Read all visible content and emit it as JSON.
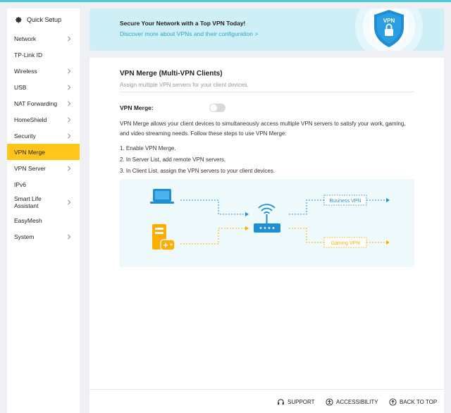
{
  "sidebar": {
    "quick_setup": "Quick Setup",
    "items": [
      {
        "label": "Network",
        "arrow": true
      },
      {
        "label": "TP-Link ID",
        "arrow": false
      },
      {
        "label": "Wireless",
        "arrow": true
      },
      {
        "label": "USB",
        "arrow": true
      },
      {
        "label": "NAT Forwarding",
        "arrow": true
      },
      {
        "label": "HomeShield",
        "arrow": true
      },
      {
        "label": "Security",
        "arrow": true
      },
      {
        "label": "VPN Merge",
        "arrow": false,
        "active": true
      },
      {
        "label": "VPN Server",
        "arrow": true
      },
      {
        "label": "IPv6",
        "arrow": false
      },
      {
        "label": "Smart Life Assistant",
        "arrow": true
      },
      {
        "label": "EasyMesh",
        "arrow": false
      },
      {
        "label": "System",
        "arrow": true
      }
    ]
  },
  "banner": {
    "title": "Secure Your Network with a Top VPN Today!",
    "link": "Discover more about VPNs and their configuration >",
    "badge": "VPN"
  },
  "main": {
    "title": "VPN Merge (Multi-VPN Clients)",
    "subtitle": "Assign multiple VPN servers for your client devices.",
    "vpn_merge_label": "VPN Merge:",
    "toggle_on": false,
    "description": "VPN Merge allows your client devices to simultaneously access multiple VPN servers to satisfy your work, gaming, and video streaming needs. Follow these steps to use VPN Merge:",
    "steps": [
      "1. Enable VPN Merge.",
      "2. In Server List, add remote VPN servers.",
      "3. In Client List, assign the VPN servers to your client devices."
    ],
    "diagram": {
      "business_label": "Business VPN",
      "gaming_label": "Gaming VPN"
    }
  },
  "footer": {
    "support": "SUPPORT",
    "accessibility": "ACCESSIBILITY",
    "back_to_top": "BACK TO TOP"
  },
  "colors": {
    "accent_yellow": "#ffc519",
    "banner_bg": "#cfeff7",
    "link_blue": "#2aa6c9",
    "device_blue": "#1f8fd3",
    "device_orange": "#ffae00"
  }
}
